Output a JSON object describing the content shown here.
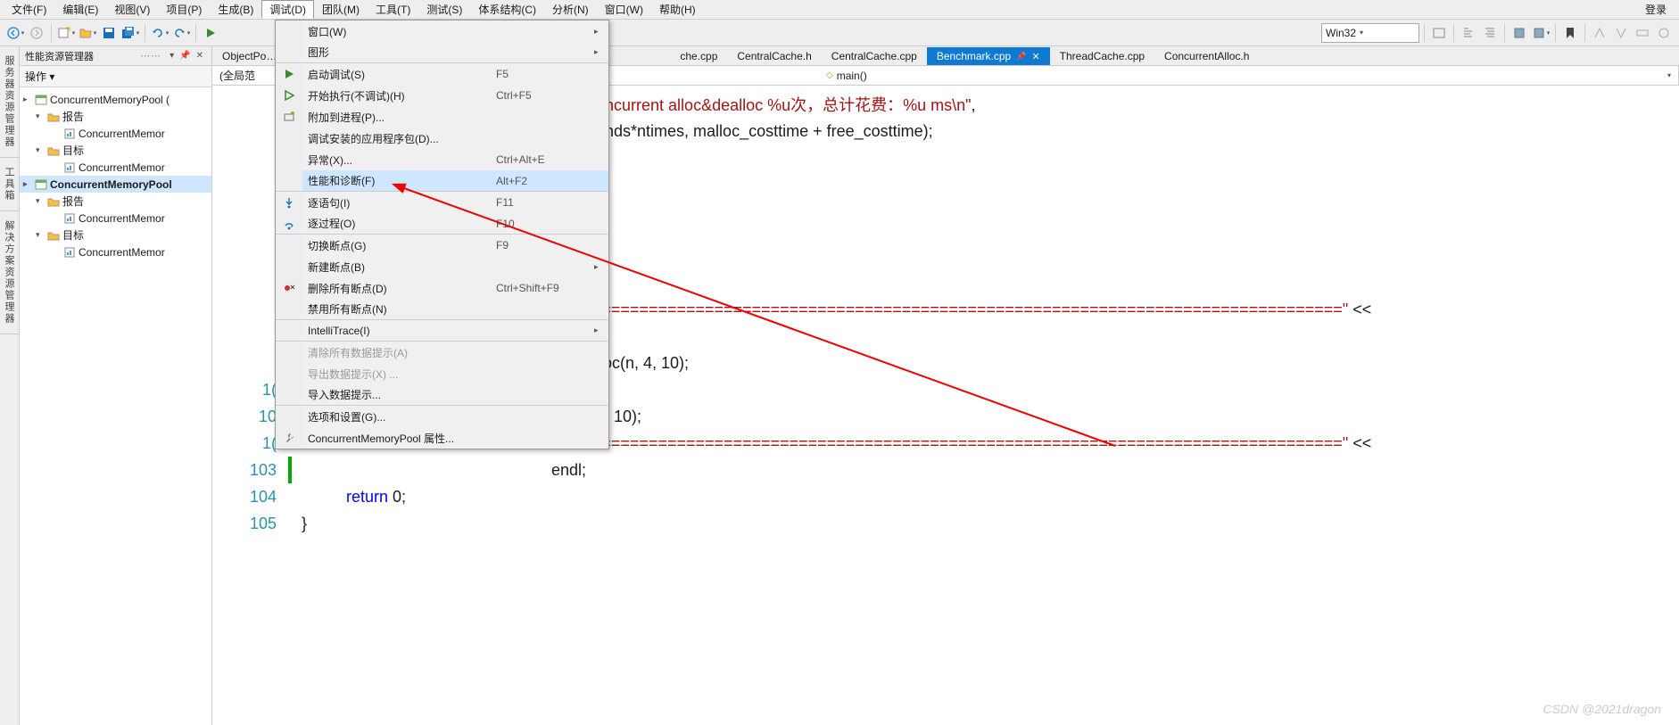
{
  "menubar": {
    "items": [
      "文件(F)",
      "编辑(E)",
      "视图(V)",
      "项目(P)",
      "生成(B)",
      "调试(D)",
      "团队(M)",
      "工具(T)",
      "测试(S)",
      "体系结构(C)",
      "分析(N)",
      "窗口(W)",
      "帮助(H)"
    ],
    "active_index": 5,
    "login": "登录"
  },
  "toolbar": {
    "platform": "Win32"
  },
  "side_tabs": [
    "服务器资源管理器",
    "工具箱",
    "解决方案资源管理器"
  ],
  "panel": {
    "title": "性能资源管理器",
    "ops": "操作",
    "tree": [
      {
        "lvl": 0,
        "exp": "▸",
        "ico": "proj",
        "label": "ConcurrentMemoryPool ("
      },
      {
        "lvl": 1,
        "exp": "▾",
        "ico": "folder",
        "label": "报告"
      },
      {
        "lvl": 2,
        "exp": "",
        "ico": "report",
        "label": "ConcurrentMemor"
      },
      {
        "lvl": 1,
        "exp": "▾",
        "ico": "folder",
        "label": "目标"
      },
      {
        "lvl": 2,
        "exp": "",
        "ico": "report",
        "label": "ConcurrentMemor"
      },
      {
        "lvl": 0,
        "exp": "▸",
        "ico": "proj",
        "label": "ConcurrentMemoryPool",
        "sel": true
      },
      {
        "lvl": 1,
        "exp": "▾",
        "ico": "folder",
        "label": "报告"
      },
      {
        "lvl": 2,
        "exp": "",
        "ico": "report",
        "label": "ConcurrentMemor"
      },
      {
        "lvl": 1,
        "exp": "▾",
        "ico": "folder",
        "label": "目标"
      },
      {
        "lvl": 2,
        "exp": "",
        "ico": "report",
        "label": "ConcurrentMemor"
      }
    ]
  },
  "doc_tabs": [
    "ObjectPo…",
    "che.cpp",
    "CentralCache.h",
    "CentralCache.cpp",
    "Benchmark.cpp",
    "ThreadCache.cpp",
    "ConcurrentAlloc.h"
  ],
  "doc_active_label": "Benchmark.cpp",
  "nav": {
    "scope": "(全局范",
    "func": "main()"
  },
  "code": {
    "eq_line": "\"===============================================================================\"",
    "printf_fmt": "oncurrent alloc&dealloc %u次，总计花费：%u ms\\n\"",
    "printf_args": "unds*ntimes, malloc_costtime + free_costtime);",
    "call": "lloc(n, 4, 10);",
    "call2": "4, 10);",
    "shl": " << ",
    "endl_tok": "endl",
    "semicolon": ";",
    "return_kw": "return",
    "return_val": " 0;",
    "brace": "}",
    "ln_10": "1(",
    "ln_101": "10",
    "ln_102": "1(",
    "ln_103": "103",
    "ln_104": "104",
    "ln_105": "105"
  },
  "dropdown": [
    {
      "ico": "",
      "label": "窗口(W)",
      "sc": "",
      "sub": true,
      "sep": false
    },
    {
      "ico": "",
      "label": "图形",
      "sc": "",
      "sub": true,
      "sep": true
    },
    {
      "ico": "play",
      "label": "启动调试(S)",
      "sc": "F5",
      "sep": false
    },
    {
      "ico": "play-o",
      "label": "开始执行(不调试)(H)",
      "sc": "Ctrl+F5",
      "sep": false
    },
    {
      "ico": "attach",
      "label": "附加到进程(P)...",
      "sc": "",
      "sep": false
    },
    {
      "ico": "",
      "label": "调试安装的应用程序包(D)...",
      "sc": "",
      "sep": false
    },
    {
      "ico": "",
      "label": "异常(X)...",
      "sc": "Ctrl+Alt+E",
      "sep": false
    },
    {
      "ico": "",
      "label": "性能和诊断(F)",
      "sc": "Alt+F2",
      "sep": true,
      "hl": true
    },
    {
      "ico": "step-in",
      "label": "逐语句(I)",
      "sc": "F11",
      "sep": false
    },
    {
      "ico": "step-over",
      "label": "逐过程(O)",
      "sc": "F10",
      "sep": true
    },
    {
      "ico": "",
      "label": "切换断点(G)",
      "sc": "F9",
      "sep": false
    },
    {
      "ico": "",
      "label": "新建断点(B)",
      "sc": "",
      "sub": true,
      "sep": false
    },
    {
      "ico": "del-bp",
      "label": "删除所有断点(D)",
      "sc": "Ctrl+Shift+F9",
      "sep": false
    },
    {
      "ico": "",
      "label": "禁用所有断点(N)",
      "sc": "",
      "sep": true
    },
    {
      "ico": "",
      "label": "IntelliTrace(I)",
      "sc": "",
      "sub": true,
      "sep": true
    },
    {
      "ico": "",
      "label": "清除所有数据提示(A)",
      "sc": "",
      "dis": true,
      "sep": false
    },
    {
      "ico": "",
      "label": "导出数据提示(X) ...",
      "sc": "",
      "dis": true,
      "sep": false
    },
    {
      "ico": "",
      "label": "导入数据提示...",
      "sc": "",
      "sep": true
    },
    {
      "ico": "",
      "label": "选项和设置(G)...",
      "sc": "",
      "sep": false
    },
    {
      "ico": "wrench",
      "label": "ConcurrentMemoryPool 属性...",
      "sc": "",
      "sep": false
    }
  ],
  "watermark": "CSDN @2021dragon"
}
